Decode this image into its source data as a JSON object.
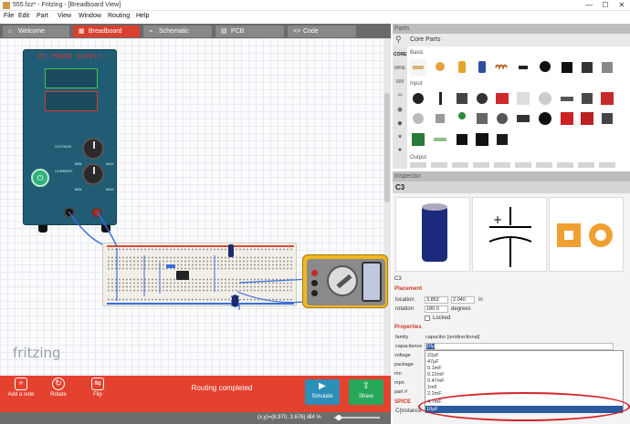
{
  "window": {
    "title": "555.fzz* - Fritzing - [Breadboard View]",
    "minimize": "—",
    "maximize": "☐",
    "close": "✕"
  },
  "menu": [
    "File",
    "Edit",
    "Part",
    "View",
    "Window",
    "Routing",
    "Help"
  ],
  "tabs": [
    {
      "label": "Welcome",
      "icon": "⌂"
    },
    {
      "label": "Breadboard",
      "icon": "▦"
    },
    {
      "label": "Schematic",
      "icon": "⌁"
    },
    {
      "label": "PCB",
      "icon": "▤"
    },
    {
      "label": "Code",
      "icon": "<>"
    }
  ],
  "canvas": {
    "psu_label": "DC POWER SUPPLY",
    "voltage": "VOLTAGE",
    "current": "CURRENT",
    "min": "MIN",
    "max": "MAX",
    "watermark": "fritzing"
  },
  "toolbar": {
    "add_note": "Add a note",
    "rotate": "Rotate",
    "flip": "Flip",
    "routing_status": "Routing completed",
    "simulate": "Simulate",
    "share": "Share"
  },
  "status": {
    "coords": "(x,y)=(8.970, 3.676) in",
    "zoom": "74 %"
  },
  "parts": {
    "header": "Parts",
    "title": "Core Parts",
    "sidebar": [
      "CORE",
      "MINE",
      "SIM"
    ],
    "sections": [
      "Basic",
      "Input",
      "Output"
    ]
  },
  "inspector": {
    "header": "Inspector",
    "title": "C3",
    "name": "C3",
    "placement_label": "Placement",
    "location_label": "location",
    "location_x": "3.852",
    "location_y": "2.040",
    "location_unit": "in",
    "rotation_label": "rotation",
    "rotation_value": "180.0",
    "rotation_unit": "degrees",
    "locked": "Locked",
    "properties_label": "Properties",
    "props": [
      {
        "name": "family",
        "value": "capacitor [unidirectional]"
      },
      {
        "name": "capacitance",
        "value": "10µ"
      },
      {
        "name": "voltage",
        "value": ""
      },
      {
        "name": "package",
        "value": ""
      },
      {
        "name": "mn",
        "value": ""
      },
      {
        "name": "mpn",
        "value": ""
      },
      {
        "name": "part #",
        "value": ""
      }
    ],
    "spice_label": "SPICE",
    "spice_row": "C{instance",
    "dropdown_options": [
      "22µF",
      "47µF",
      "0.1mF",
      "0.22mF",
      "0.47mF",
      "1mF",
      "2.2mF",
      "4.7mF",
      "10µF"
    ],
    "dropdown_selected": "10µF"
  },
  "colors": {
    "accent": "#e5412f",
    "panel_header": "#bdbdbd",
    "selection": "#2b5a9e",
    "annotation": "#d3262a"
  }
}
